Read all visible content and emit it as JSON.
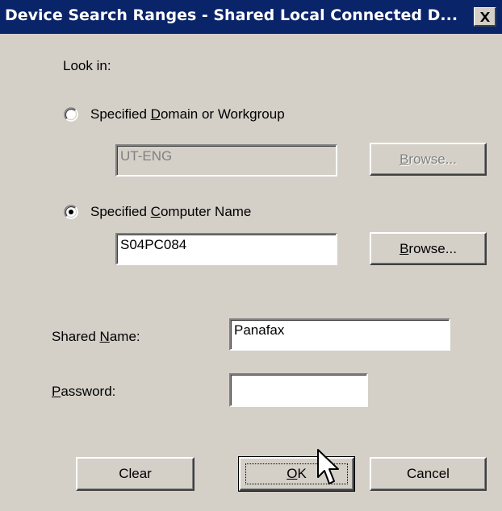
{
  "window": {
    "title": "Device Search Ranges - Shared Local Connected D..."
  },
  "look_in": {
    "label": "Look in:"
  },
  "domain_option": {
    "label_pre": "Specified ",
    "label_key": "D",
    "label_post": "omain or Workgroup",
    "selected": false,
    "value": "UT-ENG",
    "browse_pre": "",
    "browse_key": "B",
    "browse_post": "rowse...",
    "enabled": false
  },
  "computer_option": {
    "label_pre": "Specified ",
    "label_key": "C",
    "label_post": "omputer Name",
    "selected": true,
    "value": "S04PC084",
    "browse_pre": "",
    "browse_key": "B",
    "browse_post": "rowse...",
    "enabled": true
  },
  "shared_name": {
    "label_pre": "Shared ",
    "label_key": "N",
    "label_post": "ame:",
    "value": "Panafax"
  },
  "password": {
    "label_pre": "",
    "label_key": "P",
    "label_post": "assword:",
    "value": ""
  },
  "buttons": {
    "clear": "Clear",
    "ok_key": "O",
    "ok_post": "K",
    "cancel": "Cancel"
  },
  "icons": {
    "close": "close-icon",
    "cursor": "mouse-pointer-icon"
  }
}
